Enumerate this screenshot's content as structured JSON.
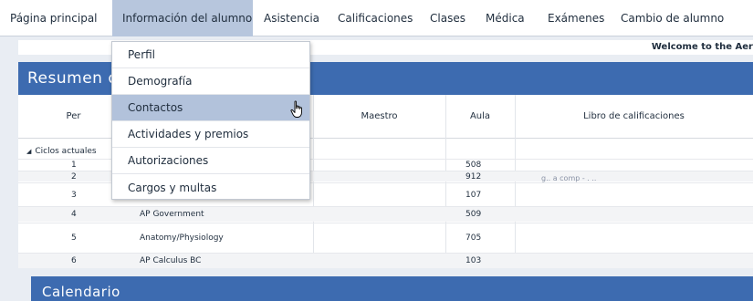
{
  "nav": {
    "items": [
      {
        "label": "Página principal"
      },
      {
        "label": "Información del alumno"
      },
      {
        "label": "Asistencia"
      },
      {
        "label": "Calificaciones"
      },
      {
        "label": "Clases"
      },
      {
        "label": "Médica"
      },
      {
        "label": "Exámenes"
      },
      {
        "label": "Cambio de alumno"
      }
    ],
    "active_index": 1
  },
  "welcome": "Welcome to the Aer",
  "panel": {
    "title": "Resumen de"
  },
  "table": {
    "headers": {
      "per": "Per",
      "teacher": "Maestro",
      "room": "Aula",
      "gradebook": "Libro de calificaciones"
    },
    "group": "Ciclos actuales",
    "rows": [
      {
        "per": "1",
        "course": "",
        "room": "508",
        "gradebook": ""
      },
      {
        "per": "2",
        "course": "",
        "room": "912",
        "gradebook": "g.. a comp - . .."
      },
      {
        "per": "3",
        "course": "",
        "room": "107",
        "gradebook": ""
      },
      {
        "per": "4",
        "course": "AP Government",
        "room": "509",
        "gradebook": ""
      },
      {
        "per": "5",
        "course": "Anatomy/Physiology",
        "room": "705",
        "gradebook": ""
      },
      {
        "per": "6",
        "course": "AP Calculus BC",
        "room": "103",
        "gradebook": ""
      }
    ]
  },
  "calendar": {
    "title": "Calendario"
  },
  "dropdown": {
    "items": [
      {
        "label": "Perfil"
      },
      {
        "label": "Demografía"
      },
      {
        "label": "Contactos"
      },
      {
        "label": "Actividades y premios"
      },
      {
        "label": "Autorizaciones"
      },
      {
        "label": "Cargos y multas"
      }
    ],
    "hover_index": 2
  },
  "colors": {
    "header_blue": "#3d6bb0",
    "active_nav": "#b7c6dd",
    "hover_item": "#b2c2db"
  },
  "icons": {
    "cursor": "hand-pointer-icon",
    "group_toggle": "collapse-triangle-icon"
  }
}
